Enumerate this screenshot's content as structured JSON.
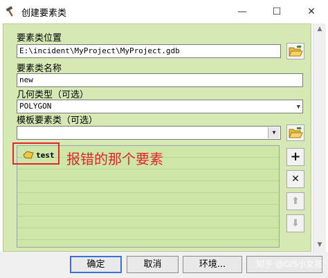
{
  "window": {
    "title": "创建要素类",
    "minimize_symbol": "—",
    "maximize_symbol": "☐",
    "close_symbol": "✕"
  },
  "form": {
    "location_label": "要素类位置",
    "location_value": "E:\\incident\\MyProject\\MyProject.gdb",
    "name_label": "要素类名称",
    "name_value": "new",
    "geometry_label": "几何类型（可选）",
    "geometry_value": "POLYGON",
    "template_label": "模板要素类（可选）",
    "template_value": ""
  },
  "list": {
    "items": [
      {
        "label": "test",
        "icon": "polygon-featureclass-icon"
      }
    ]
  },
  "annotation": {
    "text": "报错的那个要素",
    "color": "#e4242a"
  },
  "side_buttons": {
    "add": "+",
    "remove": "✕",
    "up": "⬆",
    "down": "⬇"
  },
  "footer": {
    "ok": "确定",
    "cancel": "取消",
    "environments": "环境...",
    "watermark": "知乎 @GIS小女孩"
  }
}
